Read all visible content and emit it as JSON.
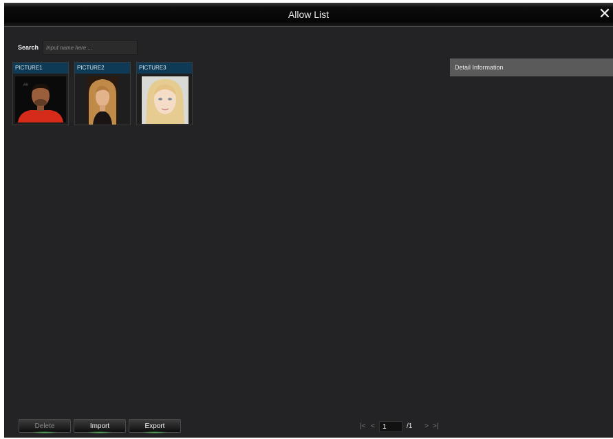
{
  "window": {
    "title": "Allow List",
    "close_icon": "close-icon"
  },
  "search": {
    "label": "Search",
    "placeholder": "Input name here ...",
    "value": ""
  },
  "pictures": [
    {
      "name": "PICTURE1"
    },
    {
      "name": "PICTURE2"
    },
    {
      "name": "PICTURE3"
    }
  ],
  "detail": {
    "title": "Detail Information"
  },
  "buttons": {
    "delete": "Delete",
    "import": "Import",
    "export": "Export"
  },
  "pagination": {
    "first": "|<",
    "prev": "<",
    "current": "1",
    "total": "/1",
    "next": ">",
    "last": ">|"
  },
  "colors": {
    "background": "#232225",
    "title_bar": "#0a0a0a",
    "card_header": "#0e3a55",
    "detail_bar": "#5a5a5a",
    "button_glow": "#4caf50"
  }
}
